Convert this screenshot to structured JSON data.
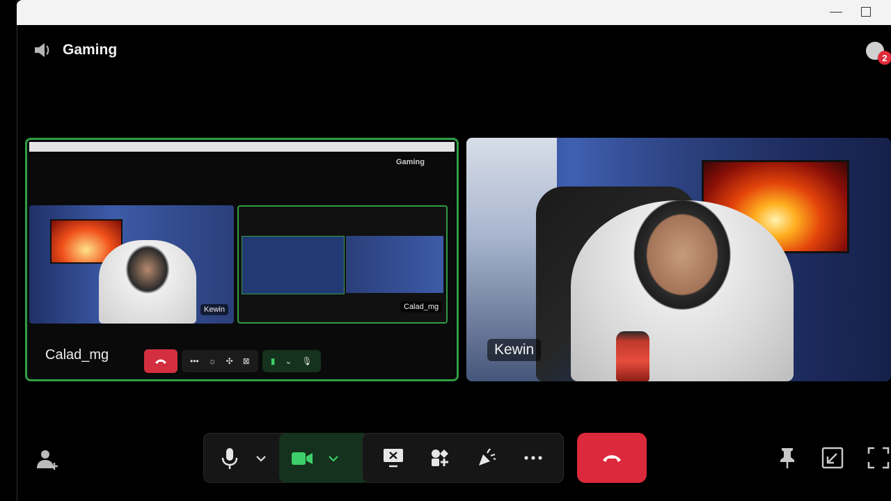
{
  "window": {
    "minimize_label": "minimize",
    "maximize_label": "maximize"
  },
  "header": {
    "channel_name": "Gaming",
    "notification_count": "2"
  },
  "tiles": {
    "left": {
      "name": "Calad_mg",
      "mirror": {
        "header": "Gaming",
        "tile1_label": "Kewin",
        "tile2_label": "Calad_mg"
      }
    },
    "right": {
      "name": "Kewin"
    }
  },
  "controls": {
    "mute_label": "Mute",
    "camera_label": "Camera",
    "share_screen_label": "Share Screen",
    "activities_label": "Activities",
    "soundboard_label": "Soundboard",
    "more_label": "More",
    "disconnect_label": "Disconnect",
    "invite_label": "Invite",
    "pin_label": "Pin",
    "popout_label": "Pop Out",
    "fullscreen_label": "Full Screen"
  },
  "colors": {
    "accent_green": "#2f9e44",
    "danger_red": "#dc2a3c",
    "background": "#000000"
  }
}
